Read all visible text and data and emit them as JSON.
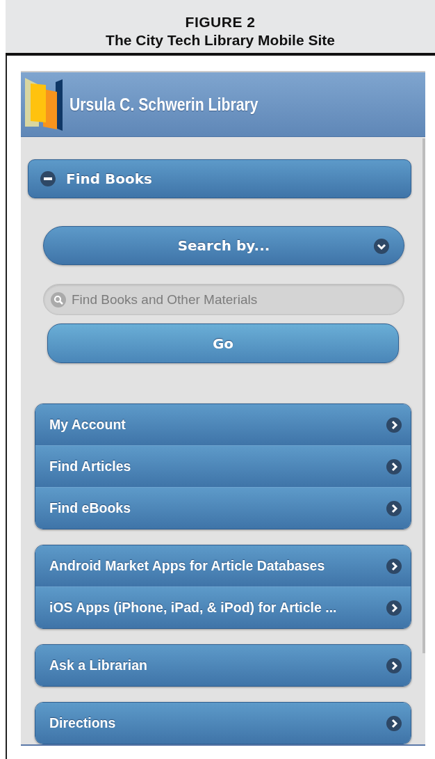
{
  "figure": {
    "number": "FIGURE 2",
    "title": "The City Tech Library Mobile Site"
  },
  "header": {
    "title": "Ursula C. Schwerin Library"
  },
  "section": {
    "label": "Find Books",
    "expanded": true
  },
  "search_by": {
    "label": "Search by..."
  },
  "search": {
    "placeholder": "Find Books and Other Materials"
  },
  "go_button": "Go",
  "menu_groups": [
    {
      "items": [
        "My Account",
        "Find Articles",
        "Find eBooks"
      ]
    },
    {
      "items": [
        "Android Market Apps for Article Databases",
        "iOS Apps (iPhone, iPad, & iPod) for Article ..."
      ]
    },
    {
      "items": [
        "Ask a Librarian"
      ]
    },
    {
      "items": [
        "Directions"
      ]
    }
  ]
}
